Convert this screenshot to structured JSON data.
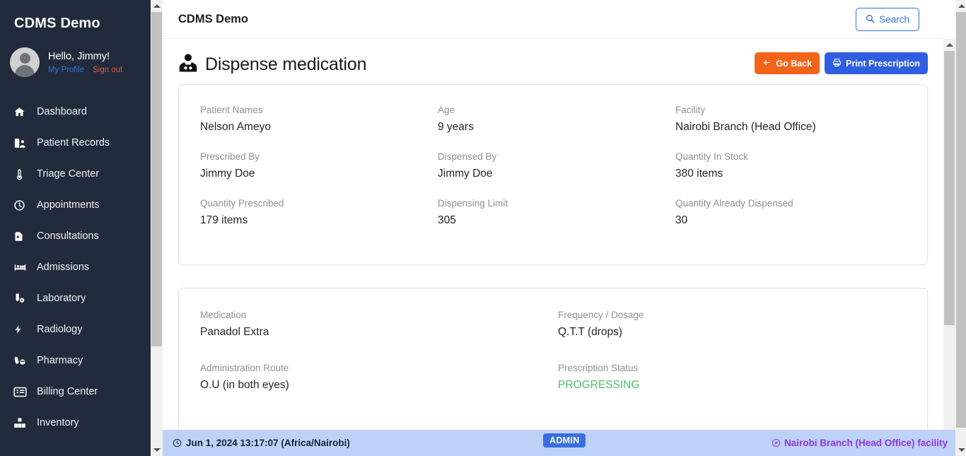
{
  "sidebar": {
    "brand": "CDMS Demo",
    "user": {
      "greeting": "Hello, Jimmy!",
      "profile_link": "My Profile",
      "signout_link": "Sign out"
    },
    "items": [
      {
        "label": "Dashboard",
        "icon": "home-icon"
      },
      {
        "label": "Patient Records",
        "icon": "patient-records-icon"
      },
      {
        "label": "Triage Center",
        "icon": "thermometer-icon"
      },
      {
        "label": "Appointments",
        "icon": "clock-icon"
      },
      {
        "label": "Consultations",
        "icon": "file-medical-icon"
      },
      {
        "label": "Admissions",
        "icon": "hospital-bed-icon"
      },
      {
        "label": "Laboratory",
        "icon": "test-tube-icon"
      },
      {
        "label": "Radiology",
        "icon": "bolt-icon"
      },
      {
        "label": "Pharmacy",
        "icon": "pills-icon"
      },
      {
        "label": "Billing Center",
        "icon": "billing-card-icon"
      },
      {
        "label": "Inventory",
        "icon": "boxes-icon"
      }
    ]
  },
  "topbar": {
    "title": "CDMS Demo",
    "search_label": "Search"
  },
  "page": {
    "title": "Dispense medication",
    "title_icon": "user-md-icon",
    "go_back_label": "Go Back",
    "print_label": "Print Prescription"
  },
  "patient_card": {
    "fields": [
      {
        "label": "Patient Names",
        "value": "Nelson Ameyo"
      },
      {
        "label": "Age",
        "value": "9 years"
      },
      {
        "label": "Facility",
        "value": "Nairobi Branch (Head Office)"
      },
      {
        "label": "Prescribed By",
        "value": "Jimmy Doe"
      },
      {
        "label": "Dispensed By",
        "value": "Jimmy Doe"
      },
      {
        "label": "Quantity In Stock",
        "value": "380 items"
      },
      {
        "label": "Quantity Prescribed",
        "value": "179 items"
      },
      {
        "label": "Dispensing Limit",
        "value": "305"
      },
      {
        "label": "Quantity Already Dispensed",
        "value": "30"
      }
    ]
  },
  "medication_card": {
    "fields": [
      {
        "label": "Medication",
        "value": "Panadol Extra",
        "status": false
      },
      {
        "label": "Frequency / Dosage",
        "value": "Q.T.T (drops)",
        "status": false
      },
      {
        "label": "Administration Route",
        "value": "O.U (in both eyes)",
        "status": false
      },
      {
        "label": "Prescription Status",
        "value": "PROGRESSING",
        "status": true
      }
    ]
  },
  "statusbar": {
    "timestamp": "Jun 1, 2024 13:17:07 (Africa/Nairobi)",
    "role_badge": "ADMIN",
    "facility": "Nairobi Branch (Head Office) facility"
  },
  "colors": {
    "sidebar_bg": "#212b3b",
    "accent_blue": "#3b6fe0",
    "orange": "#f3641a",
    "status_green": "#4cc06b",
    "statusbar_bg": "#bed2f7",
    "purple": "#9333ea"
  }
}
